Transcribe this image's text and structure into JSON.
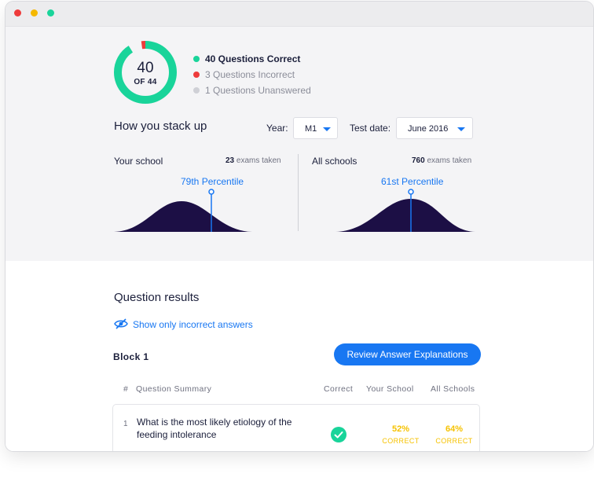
{
  "score": {
    "correct_count": "40",
    "of_total": "OF 44",
    "ring": {
      "correct": 40,
      "incorrect": 3,
      "unanswered": 1,
      "total": 44
    },
    "colors": {
      "correct": "#19d49a",
      "incorrect": "#ee3b3b",
      "unanswered": "#cfd0d6"
    }
  },
  "legend": {
    "correct": "40 Questions Correct",
    "incorrect": "3 Questions Incorrect",
    "unanswered": "1 Questions Unanswered"
  },
  "stack": {
    "title": "How you stack up",
    "year_label": "Year:",
    "year_value": "M1",
    "testdate_label": "Test date:",
    "testdate_value": "June 2016",
    "your_school": {
      "title": "Your school",
      "exams_count": "23",
      "exams_label": "exams taken",
      "percentile_label": "79th Percentile",
      "percentile": 79
    },
    "all_schools": {
      "title": "All schools",
      "exams_count": "760",
      "exams_label": "exams taken",
      "percentile_label": "61st Percentile",
      "percentile": 61
    }
  },
  "results": {
    "title": "Question results",
    "toggle_label": "Show only incorrect answers",
    "block_label": "Block 1",
    "review_button": "Review Answer Explanations",
    "columns": {
      "num": "#",
      "summary": "Question Summary",
      "correct": "Correct",
      "your_school": "Your School",
      "all_schools": "All Schools"
    },
    "rows": [
      {
        "num": "1",
        "question": "What is the most likely etiology of the feeding intolerance",
        "correct": true,
        "your_school_pct": "52%",
        "your_school_label": "CORRECT",
        "all_schools_pct": "64%",
        "all_schools_label": "CORRECT"
      }
    ]
  },
  "colors": {
    "accent": "#1877f2",
    "curve_fill": "#1c0f45",
    "success": "#19d49a",
    "warning": "#f6c200"
  }
}
